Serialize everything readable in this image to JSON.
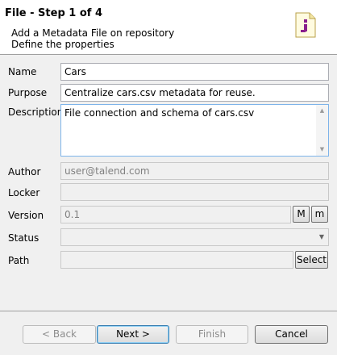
{
  "header": {
    "title": "File - Step 1 of 4",
    "line1": "Add a Metadata File on repository",
    "line2": "Define the properties",
    "icon": "metadata-file-icon"
  },
  "form": {
    "name": {
      "label": "Name",
      "value": "Cars"
    },
    "purpose": {
      "label": "Purpose",
      "value": "Centralize cars.csv metadata for reuse."
    },
    "description": {
      "label": "Description",
      "value": "File connection and schema of cars.csv"
    },
    "author": {
      "label": "Author",
      "value": "user@talend.com"
    },
    "locker": {
      "label": "Locker",
      "value": ""
    },
    "version": {
      "label": "Version",
      "value": "0.1",
      "major_label": "M",
      "minor_label": "m"
    },
    "status": {
      "label": "Status",
      "value": ""
    },
    "path": {
      "label": "Path",
      "value": "",
      "select_label": "Select"
    }
  },
  "footer": {
    "back_label": "< Back",
    "next_label": "Next >",
    "finish_label": "Finish",
    "cancel_label": "Cancel"
  },
  "colors": {
    "accent": "#3c7fb1",
    "field_border": "#abadb3",
    "disabled_text": "#808080"
  }
}
